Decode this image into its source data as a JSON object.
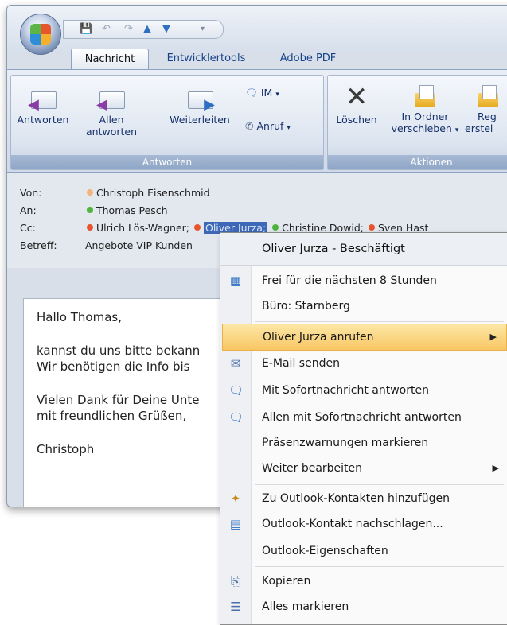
{
  "ribbon": {
    "tabs": [
      "Nachricht",
      "Entwicklertools",
      "Adobe PDF"
    ],
    "groups": {
      "antworten": "Antworten",
      "aktionen": "Aktionen"
    },
    "buttons": {
      "antworten": "Antworten",
      "allen_1": "Allen",
      "allen_2": "antworten",
      "weiterleiten": "Weiterleiten",
      "im": "IM",
      "anruf": "Anruf",
      "loeschen": "Löschen",
      "ordner_1": "In Ordner",
      "ordner_2": "verschieben",
      "regeln_1": "Reg",
      "regeln_2": "erstel"
    }
  },
  "header": {
    "von_label": "Von:",
    "von": "Christoph Eisenschmid",
    "an_label": "An:",
    "an": "Thomas Pesch",
    "cc_label": "Cc:",
    "cc_1": "Ulrich Lös-Wagner;",
    "cc_2": "Oliver Jurza;",
    "cc_3": "Christine Dowid;",
    "cc_4": "Sven Hast",
    "betreff_label": "Betreff:",
    "betreff": "Angebote VIP Kunden"
  },
  "body": {
    "line1": "Hallo Thomas,",
    "line2": "kannst du uns bitte bekann",
    "line3": "Wir benötigen die Info bis",
    "line4": "Vielen Dank für Deine Unte",
    "line5": "mit freundlichen Grüßen,",
    "line6": "Christoph"
  },
  "menu": {
    "title": "Oliver Jurza - Beschäftigt",
    "items": [
      "Frei für die nächsten 8 Stunden",
      "Büro: Starnberg",
      "Oliver Jurza anrufen",
      "E-Mail senden",
      "Mit Sofortnachricht antworten",
      "Allen mit Sofortnachricht antworten",
      "Präsenzwarnungen markieren",
      "Weiter bearbeiten",
      "Zu Outlook-Kontakten hinzufügen",
      "Outlook-Kontakt nachschlagen...",
      "Outlook-Eigenschaften",
      "Kopieren",
      "Alles markieren"
    ]
  },
  "colors": {
    "presence_busy": "#e8542b",
    "presence_available": "#4fb33c",
    "presence_away": "#f4b47a",
    "menu_highlight": "#f8c663"
  }
}
